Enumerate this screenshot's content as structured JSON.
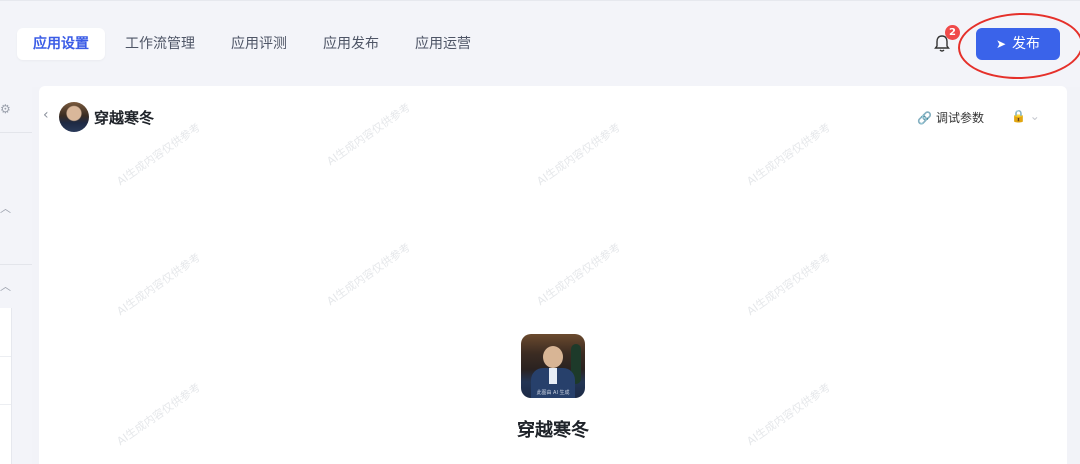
{
  "header": {
    "tabs": [
      {
        "label": "应用设置",
        "active": true
      },
      {
        "label": "工作流管理",
        "active": false
      },
      {
        "label": "应用评测",
        "active": false
      },
      {
        "label": "应用发布",
        "active": false
      },
      {
        "label": "应用运营",
        "active": false
      }
    ],
    "notification_count": "2",
    "publish_label": "发布",
    "accent_color": "#3a63ea",
    "annotation_color": "#e5302a"
  },
  "card": {
    "title": "穿越寒冬",
    "debug_label": "调试参数",
    "center_name": "穿越寒冬",
    "avatar_caption": "此图由 AI 生成"
  },
  "watermark_text": "AI生成内容仅供参考",
  "icons": {
    "bell": "bell-icon",
    "publish": "send-icon",
    "back": "chevron-left-icon",
    "debug": "link-icon",
    "lock": "lock-icon"
  }
}
